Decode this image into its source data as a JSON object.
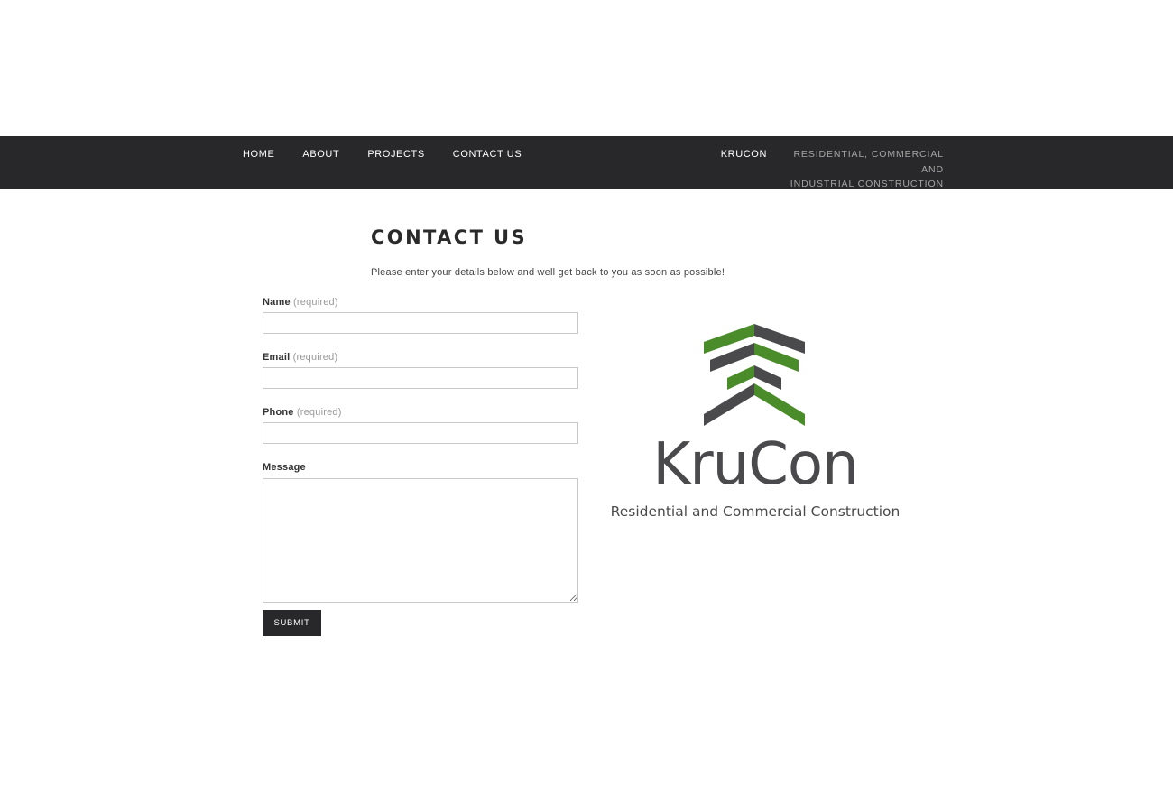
{
  "nav": {
    "links": [
      "HOME",
      "ABOUT",
      "PROJECTS",
      "CONTACT US"
    ],
    "brand_name": "KRUCON",
    "brand_tagline_line1": "RESIDENTIAL, COMMERCIAL AND",
    "brand_tagline_line2": "INDUSTRIAL CONSTRUCTION"
  },
  "page": {
    "title": "CONTACT US",
    "intro": "Please enter your details below and well get back to you as soon as possible!"
  },
  "form": {
    "required_note": "(required)",
    "name_label": "Name",
    "email_label": "Email",
    "phone_label": "Phone",
    "message_label": "Message",
    "submit_label": "SUBMIT"
  },
  "logo": {
    "wordmark": "KruCon",
    "subtitle": "Residential and Commercial Construction",
    "green": "#4a8c2a",
    "gray": "#4a4a4c"
  },
  "colors": {
    "navbar_bg": "#28282a"
  }
}
